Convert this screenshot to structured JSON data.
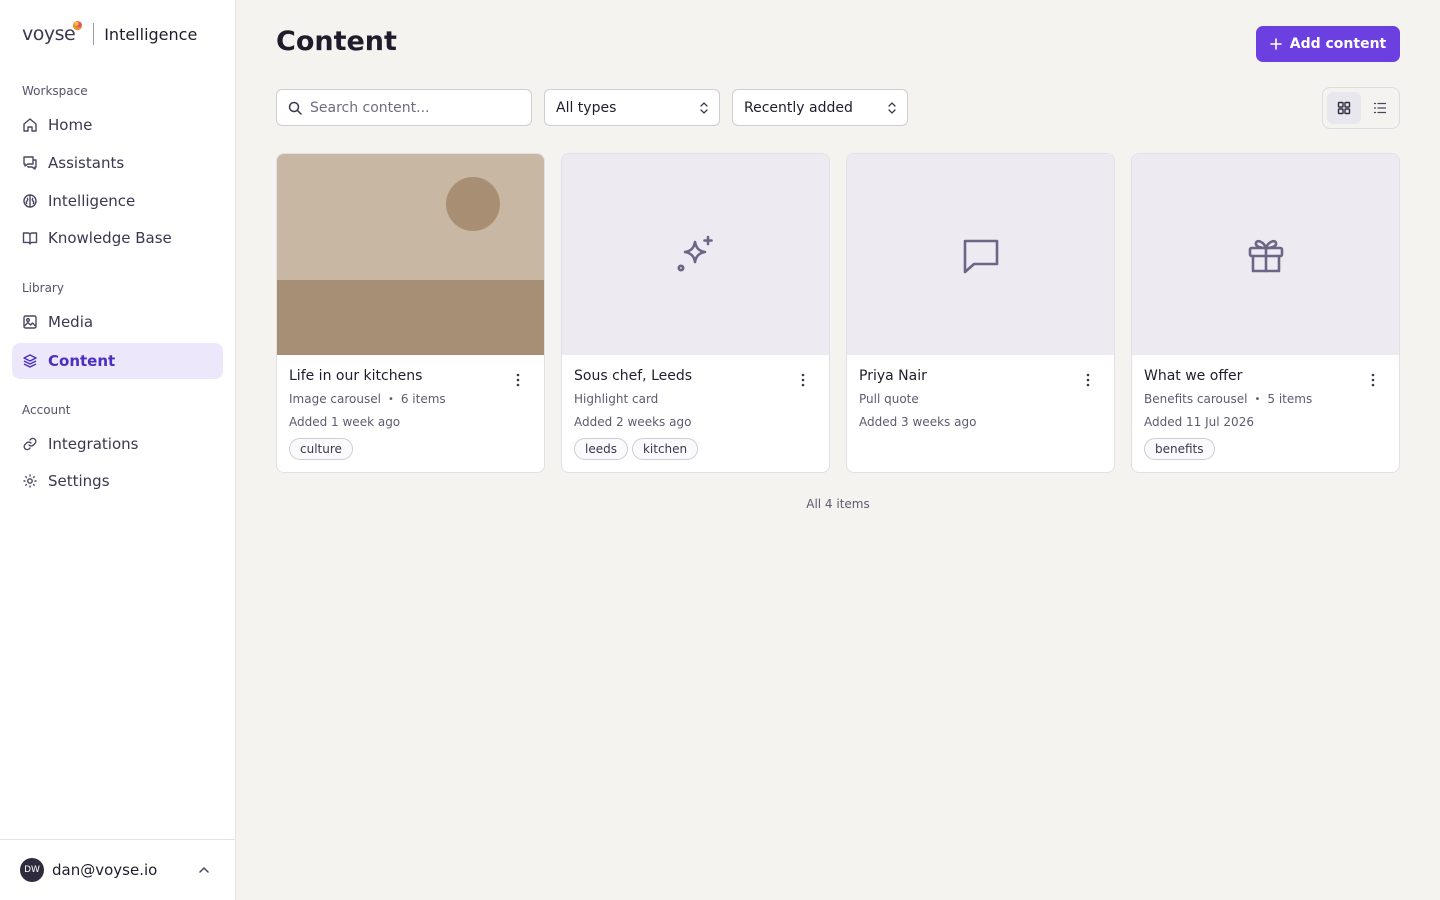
{
  "brand": {
    "logo_text": "voyse",
    "product": "Intelligence"
  },
  "sidebar": {
    "sections": [
      {
        "label": "Workspace"
      },
      {
        "label": "Library"
      },
      {
        "label": "Account"
      }
    ],
    "items": [
      {
        "label": "Home",
        "icon": "home-icon"
      },
      {
        "label": "Assistants",
        "icon": "chat-bubbles-icon"
      },
      {
        "label": "Intelligence",
        "icon": "brain-icon"
      },
      {
        "label": "Knowledge Base",
        "icon": "book-icon"
      },
      {
        "label": "Media",
        "icon": "image-icon"
      },
      {
        "label": "Content",
        "icon": "layers-icon",
        "active": true
      },
      {
        "label": "Integrations",
        "icon": "link-icon"
      },
      {
        "label": "Settings",
        "icon": "gear-icon"
      }
    ],
    "user": {
      "initials": "DW",
      "email": "dan@voyse.io"
    }
  },
  "main": {
    "title": "Content",
    "add_button": "Add content",
    "search": {
      "placeholder": "Search content...",
      "value": ""
    },
    "type_filter": "All types",
    "sort": "Recently added",
    "view_mode": "grid",
    "cards": [
      {
        "title": "Life in our kitchens",
        "type": "Image carousel",
        "count": "6 items",
        "added": "Added 1 week ago",
        "tags": [
          "culture"
        ],
        "thumb": "photo"
      },
      {
        "title": "Sous chef, Leeds",
        "type": "Highlight card",
        "count": "",
        "added": "Added 2 weeks ago",
        "tags": [
          "leeds",
          "kitchen"
        ],
        "thumb": "sparkles-icon"
      },
      {
        "title": "Priya Nair",
        "type": "Pull quote",
        "count": "",
        "added": "Added 3 weeks ago",
        "tags": [],
        "thumb": "message-square-icon"
      },
      {
        "title": "What we offer",
        "type": "Benefits carousel",
        "count": "5 items",
        "added": "Added 11 Jul 2026",
        "tags": [
          "benefits"
        ],
        "thumb": "gift-icon"
      }
    ],
    "footer_count": "All 4 items"
  },
  "colors": {
    "accent": "#6b3fe0",
    "active_bg": "#ece7fb",
    "active_text": "#4a2fc0",
    "page_bg": "#f4f3ef"
  }
}
